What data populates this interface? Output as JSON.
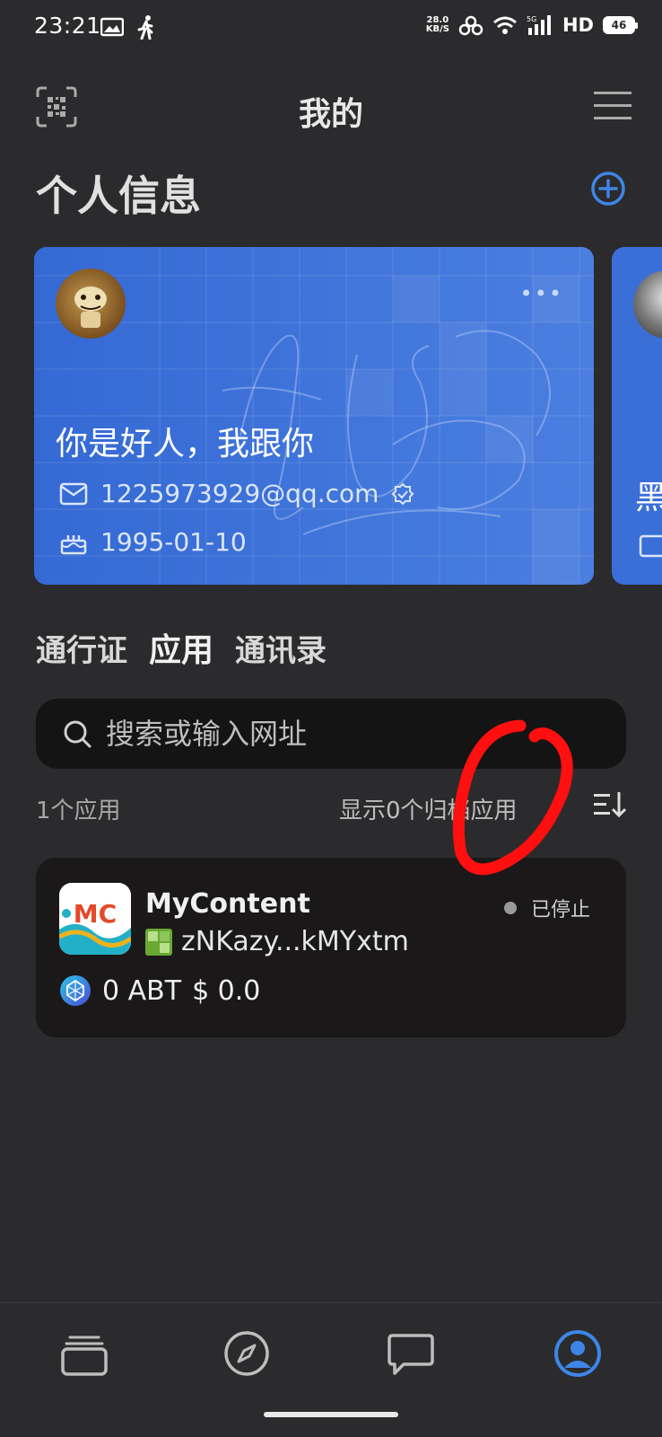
{
  "status_bar": {
    "time": "23:21",
    "net_speed_value": "28.0",
    "net_speed_unit": "KB/S",
    "network_type": "5G",
    "hd_label": "HD",
    "battery": "46"
  },
  "header": {
    "title": "我的"
  },
  "profile_section": {
    "title": "个人信息",
    "cards": [
      {
        "name": "你是好人，我跟你",
        "email": "1225973929@qq.com",
        "birthday": "1995-01-10",
        "more_label": "•••"
      },
      {
        "name": "黑"
      }
    ]
  },
  "tabs": [
    "通行证",
    "应用",
    "通讯录"
  ],
  "active_tab": "应用",
  "search": {
    "placeholder": "搜索或输入网址"
  },
  "apps_meta": {
    "count_label": "1个应用",
    "archived_label": "显示0个归档应用"
  },
  "apps": [
    {
      "name": "MyContent",
      "status": "已停止",
      "did": "zNKazy...kMYxtm",
      "balance_token": "0 ABT",
      "balance_usd": "$ 0.0",
      "logo_text": "MC"
    }
  ],
  "colors": {
    "background": "#2b2b2d",
    "card_blue": "#3a6fd8",
    "accent_blue": "#3d86e8",
    "annotation_red": "#ff0f0f"
  },
  "bottom_nav": [
    "wallet-icon",
    "compass-icon",
    "chat-icon",
    "profile-icon"
  ]
}
